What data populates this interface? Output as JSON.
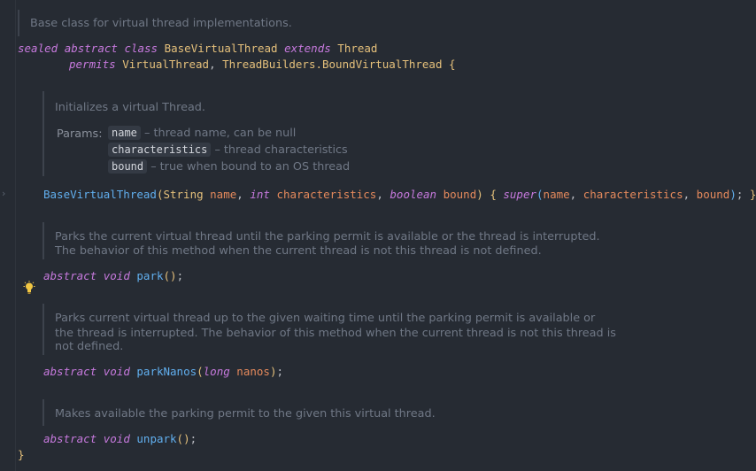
{
  "class_doc": "Base class for virtual thread implementations.",
  "class_decl": {
    "kw1": "sealed",
    "kw2": "abstract",
    "kw3": "class",
    "name": "BaseVirtualThread",
    "kw4": "extends",
    "super": "Thread",
    "permits_kw": "permits",
    "permitted1": "VirtualThread",
    "comma": ",",
    "permitted2": "ThreadBuilders.BoundVirtualThread",
    "open": "{"
  },
  "ctor_doc": {
    "summary": "Initializes a virtual Thread.",
    "params_label": "Params:",
    "params": [
      {
        "name": "name",
        "desc": "– thread name, can be null"
      },
      {
        "name": "characteristics",
        "desc": "– thread characteristics"
      },
      {
        "name": "bound",
        "desc": "– true when bound to an OS thread"
      }
    ]
  },
  "ctor": {
    "name": "BaseVirtualThread",
    "p1type": "String",
    "p1": "name",
    "p2type": "int",
    "p2": "characteristics",
    "p3type": "boolean",
    "p3": "bound",
    "body_open": "{",
    "super_kw": "super",
    "a1": "name",
    "a2": "characteristics",
    "a3": "bound",
    "body_close": "}"
  },
  "park_doc": {
    "line1": "Parks the current virtual thread until the parking permit is available or the thread is interrupted.",
    "line2": "The behavior of this method when the current thread is not this thread is not defined."
  },
  "park": {
    "kw1": "abstract",
    "kw2": "void",
    "name": "park"
  },
  "parknanos_doc": {
    "line1": "Parks current virtual thread up to the given waiting time until the parking permit is available or",
    "line2": "the thread is interrupted. The behavior of this method when the current thread is not this thread is",
    "line3": "not defined."
  },
  "parknanos": {
    "kw1": "abstract",
    "kw2": "void",
    "name": "parkNanos",
    "ptype": "long",
    "pname": "nanos"
  },
  "unpark_doc": "Makes available the parking permit to the given this virtual thread.",
  "unpark": {
    "kw1": "abstract",
    "kw2": "void",
    "name": "unpark"
  },
  "close_brace": "}",
  "icons": {
    "fold": "chevron-right-icon",
    "intention": "lightbulb-icon"
  }
}
